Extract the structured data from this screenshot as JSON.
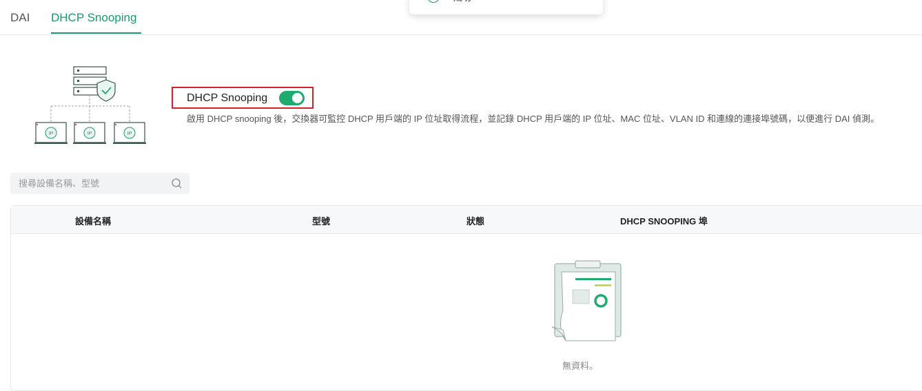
{
  "tabs": [
    {
      "label": "DAI"
    },
    {
      "label": "DHCP Snooping"
    }
  ],
  "toast": {
    "text": "成功"
  },
  "dhcp": {
    "toggle_label": "DHCP Snooping",
    "enabled": true,
    "description": "啟用 DHCP snooping 後，交換器可監控 DHCP 用戶端的 IP 位址取得流程，並記錄 DHCP 用戶端的 IP 位址、MAC 位址、VLAN ID 和連線的連接埠號碼，以便進行 DAI 偵測。"
  },
  "illustration": {
    "ip_label": "IP"
  },
  "search": {
    "placeholder": "搜尋設備名稱、型號"
  },
  "table": {
    "columns": [
      "設備名稱",
      "型號",
      "狀態",
      "DHCP SNOOPING 埠"
    ],
    "rows": [],
    "empty_text": "無資料。"
  },
  "colors": {
    "accent": "#1a9a6c",
    "highlight_border": "#d3202a"
  }
}
